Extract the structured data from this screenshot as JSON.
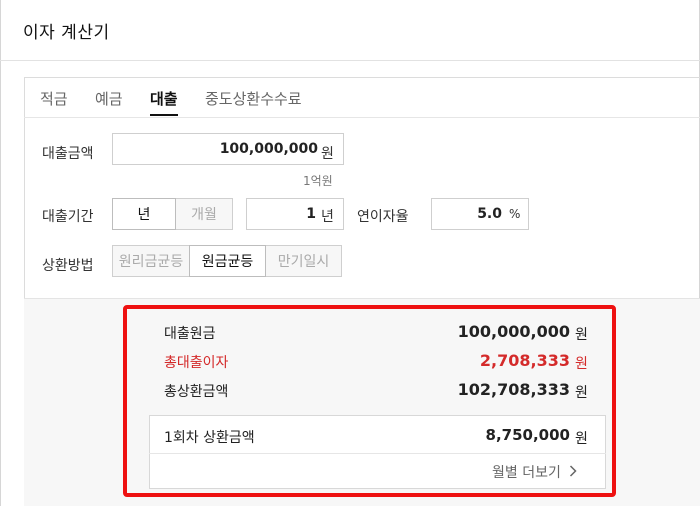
{
  "header": {
    "title": "이자 계산기"
  },
  "tabs": [
    {
      "label": "적금",
      "active": false
    },
    {
      "label": "예금",
      "active": false
    },
    {
      "label": "대출",
      "active": true
    },
    {
      "label": "중도상환수수료",
      "active": false
    }
  ],
  "form": {
    "loan_amount": {
      "label": "대출금액",
      "value": "100,000,000",
      "unit": "원",
      "hint": "1억원"
    },
    "loan_period": {
      "label": "대출기간",
      "unit_options": [
        {
          "label": "년",
          "selected": true
        },
        {
          "label": "개월",
          "selected": false
        }
      ],
      "value": "1",
      "unit": "년"
    },
    "interest_rate": {
      "label": "연이자율",
      "value": "5.0",
      "unit": "%"
    },
    "repayment": {
      "label": "상환방법",
      "options": [
        {
          "label": "원리금균등",
          "selected": false
        },
        {
          "label": "원금균등",
          "selected": true
        },
        {
          "label": "만기일시",
          "selected": false
        }
      ]
    }
  },
  "results": {
    "principal": {
      "label": "대출원금",
      "value": "100,000,000",
      "unit": "원"
    },
    "total_interest": {
      "label": "총대출이자",
      "value": "2,708,333",
      "unit": "원"
    },
    "total_repayment": {
      "label": "총상환금액",
      "value": "102,708,333",
      "unit": "원"
    },
    "first_payment": {
      "label": "1회차 상환금액",
      "value": "8,750,000",
      "unit": "원"
    },
    "monthly_link": "월별 더보기"
  },
  "colors": {
    "highlight": "#ee1111",
    "interest_text": "#d42a2a"
  },
  "icons": {
    "more_link": "chevron-right-icon"
  }
}
